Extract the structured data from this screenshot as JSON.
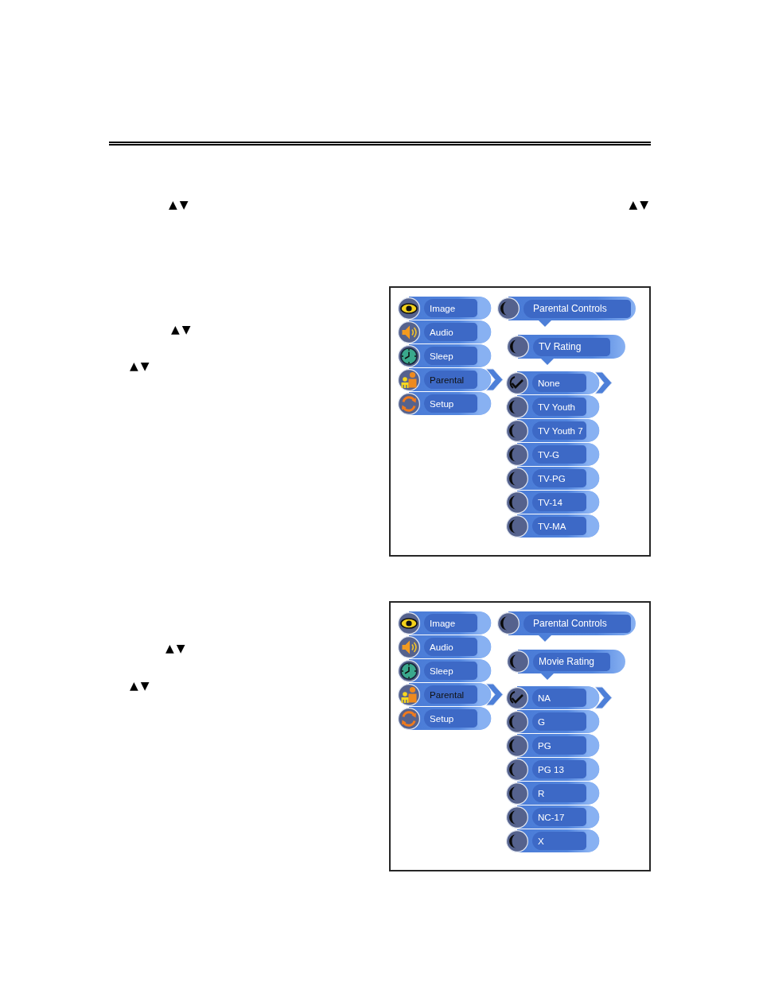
{
  "intro": {
    "arrow_hints": [
      "▲▼",
      "▲▼"
    ]
  },
  "sections": [
    {
      "arrow_hints": [
        "▲▼",
        "▲▼"
      ],
      "menu_screen": {
        "main_menu": [
          {
            "label": "Image",
            "selected": false
          },
          {
            "label": "Audio",
            "selected": false
          },
          {
            "label": "Sleep",
            "selected": false
          },
          {
            "label": "Parental",
            "selected": true
          },
          {
            "label": "Setup",
            "selected": false
          }
        ],
        "panel_title": "Parental Controls",
        "submenu_title": "TV Rating",
        "options": [
          {
            "label": "None",
            "checked": true,
            "selected": true
          },
          {
            "label": "TV Youth",
            "checked": false,
            "selected": false
          },
          {
            "label": "TV Youth 7",
            "checked": false,
            "selected": false
          },
          {
            "label": "TV-G",
            "checked": false,
            "selected": false
          },
          {
            "label": "TV-PG",
            "checked": false,
            "selected": false
          },
          {
            "label": "TV-14",
            "checked": false,
            "selected": false
          },
          {
            "label": "TV-MA",
            "checked": false,
            "selected": false
          }
        ]
      }
    },
    {
      "arrow_hints": [
        "▲▼",
        "▲▼"
      ],
      "menu_screen": {
        "main_menu": [
          {
            "label": "Image",
            "selected": false
          },
          {
            "label": "Audio",
            "selected": false
          },
          {
            "label": "Sleep",
            "selected": false
          },
          {
            "label": "Parental",
            "selected": true
          },
          {
            "label": "Setup",
            "selected": false
          }
        ],
        "panel_title": "Parental Controls",
        "submenu_title": "Movie Rating",
        "options": [
          {
            "label": "NA",
            "checked": true,
            "selected": true
          },
          {
            "label": "G",
            "checked": false,
            "selected": false
          },
          {
            "label": "PG",
            "checked": false,
            "selected": false
          },
          {
            "label": "PG 13",
            "checked": false,
            "selected": false
          },
          {
            "label": "R",
            "checked": false,
            "selected": false
          },
          {
            "label": "NC-17",
            "checked": false,
            "selected": false
          },
          {
            "label": "X",
            "checked": false,
            "selected": false
          }
        ]
      }
    }
  ]
}
